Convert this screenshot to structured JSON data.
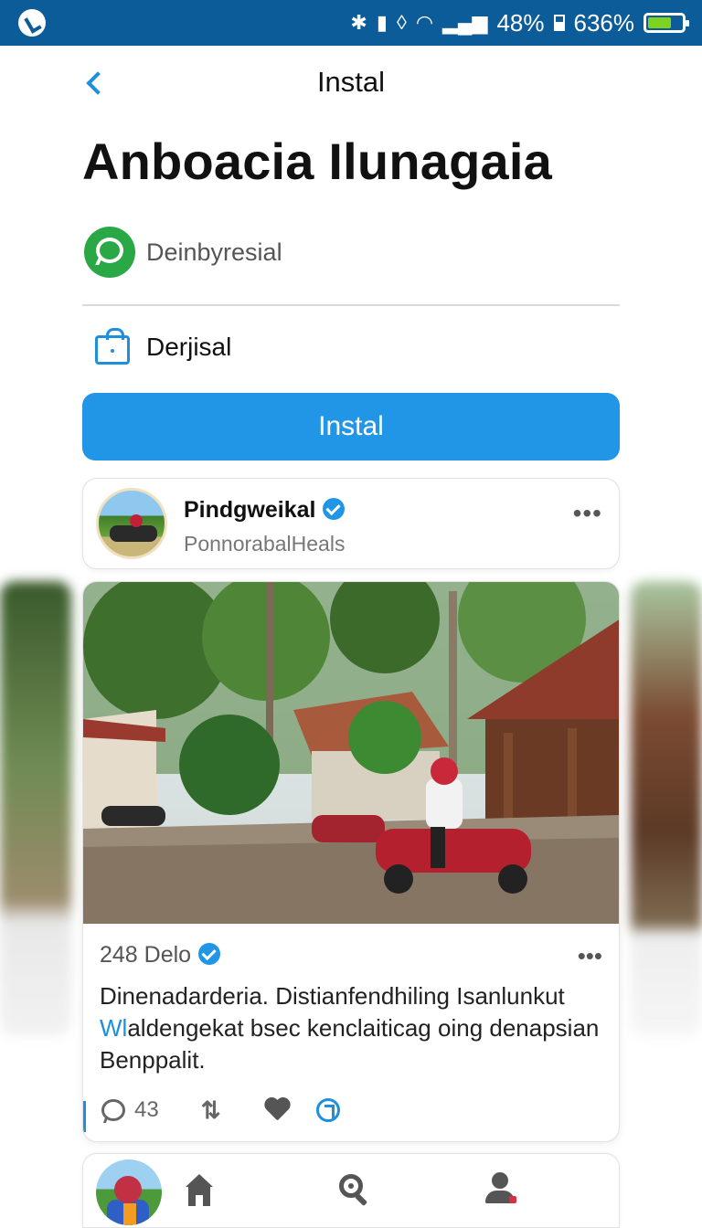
{
  "status_bar": {
    "battery_primary": "48%",
    "battery_secondary": "636%",
    "battery_fill": 0.7,
    "icons": [
      "app-dot-icon",
      "bluetooth-icon",
      "sim-icon",
      "vibrate-icon",
      "wifi-icon",
      "signal-icon",
      "battery-small-icon",
      "battery-icon"
    ]
  },
  "header": {
    "back_icon": "chevron-left-icon",
    "title": "Instal"
  },
  "app": {
    "name": "Anboacia Ilunagaia",
    "developer_icon": "chat-bubble-icon",
    "developer": "Deinbyresial",
    "category_icon": "shopping-bag-icon",
    "category": "Derjisal",
    "install_label": "Instal"
  },
  "profile": {
    "name": "Pindgweikal",
    "subtitle": "PonnorabalHeals",
    "more": "•••"
  },
  "post": {
    "author": "248 Delo",
    "more": "•••",
    "line1": "Dinenadarderia. Distianfendhiling Isanlunkut",
    "line2_hl": "Wl",
    "line2_rest": "aldengekat bsec kenclaiticag oing denapsian",
    "line3": "Benppalit.",
    "comment_count": "43"
  },
  "colors": {
    "accent": "#2196e6",
    "status_bar": "#0b5c99",
    "developer_badge": "#2aa846"
  },
  "bottom_nav": {
    "items": [
      "avatar",
      "home-icon",
      "search-icon",
      "profile-icon"
    ]
  }
}
